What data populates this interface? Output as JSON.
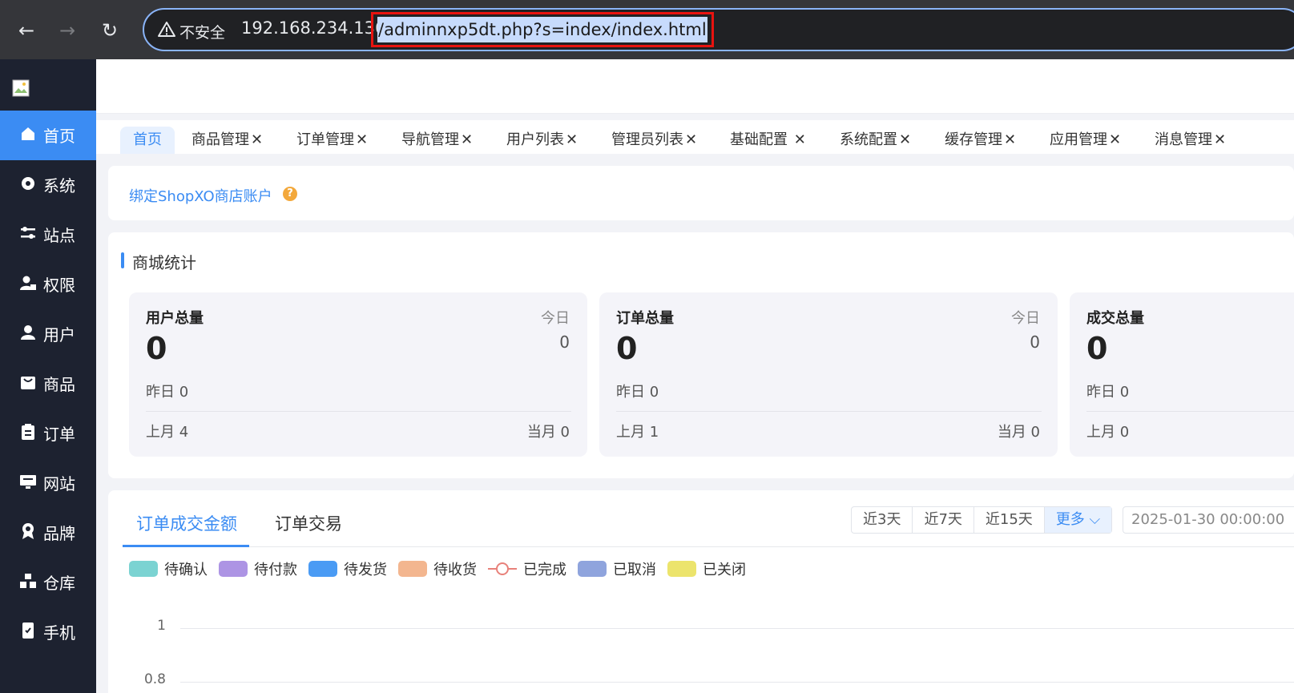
{
  "browser": {
    "back": "←",
    "forward": "→",
    "reload": "↻",
    "insecure": "不安全",
    "url_host": "192.168.234.136",
    "url_path": "/adminnxp5dt.php?s=index/index.html"
  },
  "sidebar": {
    "items": [
      {
        "label": "首页",
        "icon": "home-icon"
      },
      {
        "label": "系统",
        "icon": "gear-icon"
      },
      {
        "label": "站点",
        "icon": "sliders-icon"
      },
      {
        "label": "权限",
        "icon": "user-lock-icon"
      },
      {
        "label": "用户",
        "icon": "user-icon"
      },
      {
        "label": "商品",
        "icon": "bag-icon"
      },
      {
        "label": "订单",
        "icon": "clipboard-icon"
      },
      {
        "label": "网站",
        "icon": "monitor-icon"
      },
      {
        "label": "品牌",
        "icon": "award-icon"
      },
      {
        "label": "仓库",
        "icon": "warehouse-icon"
      },
      {
        "label": "手机",
        "icon": "phone-icon"
      }
    ],
    "accent": "#3b8cf3"
  },
  "tabs": [
    {
      "label": "首页",
      "close": ""
    },
    {
      "label": "商品管理",
      "close": "✕"
    },
    {
      "label": "订单管理",
      "close": "✕"
    },
    {
      "label": "导航管理",
      "close": "✕"
    },
    {
      "label": "用户列表",
      "close": "✕"
    },
    {
      "label": "管理员列表",
      "close": "✕"
    },
    {
      "label": "基础配置",
      "close": " ✕"
    },
    {
      "label": "系统配置",
      "close": "✕"
    },
    {
      "label": "缓存管理",
      "close": "✕"
    },
    {
      "label": "应用管理",
      "close": "✕"
    },
    {
      "label": "消息管理",
      "close": "✕"
    }
  ],
  "bind_account": {
    "label": "绑定ShopXO商店账户",
    "help": "?"
  },
  "stats": {
    "title": "商城统计",
    "cards": [
      {
        "title": "用户总量",
        "today_label": "今日",
        "today": "0",
        "total": "0",
        "yesterday": "昨日   0",
        "last_month": "上月   4",
        "this_month": "当月   0"
      },
      {
        "title": "订单总量",
        "today_label": "今日",
        "today": "0",
        "total": "0",
        "yesterday": "昨日 0",
        "last_month": "上月   1",
        "this_month": "当月   0"
      },
      {
        "title": "成交总量",
        "today_label": "",
        "today": "",
        "total": "0",
        "yesterday": "昨日 0",
        "last_month": "上月   0",
        "this_month": ""
      }
    ]
  },
  "chart_section": {
    "tabs": [
      "订单成交金额",
      "订单交易"
    ],
    "ranges": [
      "近3天",
      "近7天",
      "近15天",
      "更多 ⌵"
    ],
    "start_date": "2025-01-30 00:00:00",
    "legend": [
      {
        "label": "待确认",
        "color": "#7bd3d2",
        "type": "swatch"
      },
      {
        "label": "待付款",
        "color": "#ad94e4",
        "type": "swatch"
      },
      {
        "label": "待发货",
        "color": "#4a9bf4",
        "type": "swatch"
      },
      {
        "label": "待收货",
        "color": "#f3b68f",
        "type": "swatch"
      },
      {
        "label": "已完成",
        "color": "#e8817a",
        "type": "line"
      },
      {
        "label": "已取消",
        "color": "#8fa4dd",
        "type": "swatch"
      },
      {
        "label": "已关闭",
        "color": "#ece46c",
        "type": "swatch"
      }
    ],
    "y_ticks": [
      "1",
      "0.8"
    ]
  }
}
